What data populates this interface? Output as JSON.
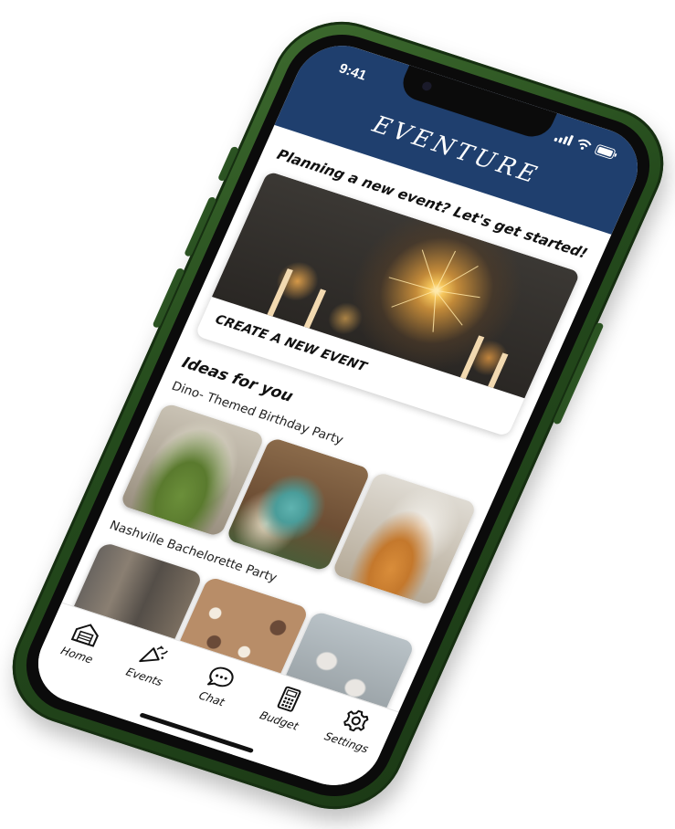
{
  "status_bar": {
    "time": "9:41"
  },
  "header": {
    "title": "EVENTURE",
    "background": "#1f3f6e"
  },
  "hero": {
    "prompt": "Planning a new event? Let's get started!",
    "card_label": "CREATE A NEW EVENT"
  },
  "ideas": {
    "section_title": "Ideas for you",
    "items": [
      {
        "title": "Dino- Themed Birthday Party",
        "photos": [
          "dinosaur-cake",
          "party-table",
          "snack-board"
        ]
      },
      {
        "title": "Nashville Bachelorette Party",
        "photos": [
          "nashville-street",
          "cowboy-confetti",
          "cowboy-hats"
        ]
      }
    ]
  },
  "tab_bar": {
    "tabs": [
      {
        "label": "Home",
        "icon": "home-icon"
      },
      {
        "label": "Events",
        "icon": "party-popper-icon"
      },
      {
        "label": "Chat",
        "icon": "chat-icon"
      },
      {
        "label": "Budget",
        "icon": "calculator-icon"
      },
      {
        "label": "Settings",
        "icon": "gear-icon"
      }
    ]
  },
  "colors": {
    "phone_body": "#2f5a25",
    "header": "#1f3f6e",
    "text": "#111111"
  }
}
